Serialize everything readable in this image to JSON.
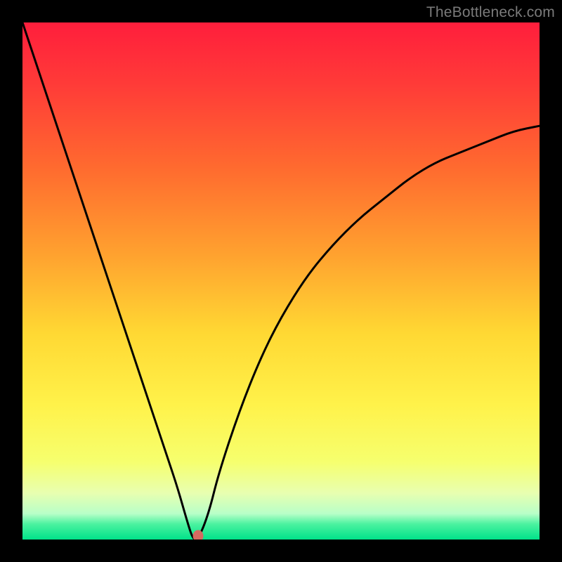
{
  "watermark": "TheBottleneck.com",
  "chart_data": {
    "type": "line",
    "title": "",
    "xlabel": "",
    "ylabel": "",
    "xlim": [
      0,
      100
    ],
    "ylim": [
      0,
      100
    ],
    "series": [
      {
        "name": "bottleneck-curve",
        "x": [
          0,
          4,
          8,
          12,
          16,
          20,
          24,
          28,
          30,
          32,
          33,
          34,
          36,
          38,
          42,
          46,
          50,
          55,
          60,
          65,
          70,
          75,
          80,
          85,
          90,
          95,
          100
        ],
        "y": [
          100,
          88,
          76,
          64,
          52,
          40,
          28,
          16,
          10,
          3,
          0,
          0,
          5,
          13,
          25,
          35,
          43,
          51,
          57,
          62,
          66,
          70,
          73,
          75,
          77,
          79,
          80
        ]
      }
    ],
    "marker": {
      "x": 34,
      "y": 0,
      "color": "#d46a60"
    },
    "gradient_stops": [
      {
        "pct": 0,
        "color": "#ff1e3c"
      },
      {
        "pct": 12,
        "color": "#ff3b38"
      },
      {
        "pct": 28,
        "color": "#ff6a2f"
      },
      {
        "pct": 45,
        "color": "#ffa22f"
      },
      {
        "pct": 60,
        "color": "#ffd833"
      },
      {
        "pct": 74,
        "color": "#fff24a"
      },
      {
        "pct": 85,
        "color": "#f6ff6e"
      },
      {
        "pct": 91,
        "color": "#e8ffb0"
      },
      {
        "pct": 95,
        "color": "#b8ffc8"
      },
      {
        "pct": 97,
        "color": "#4bf2a0"
      },
      {
        "pct": 100,
        "color": "#00e28a"
      }
    ]
  }
}
